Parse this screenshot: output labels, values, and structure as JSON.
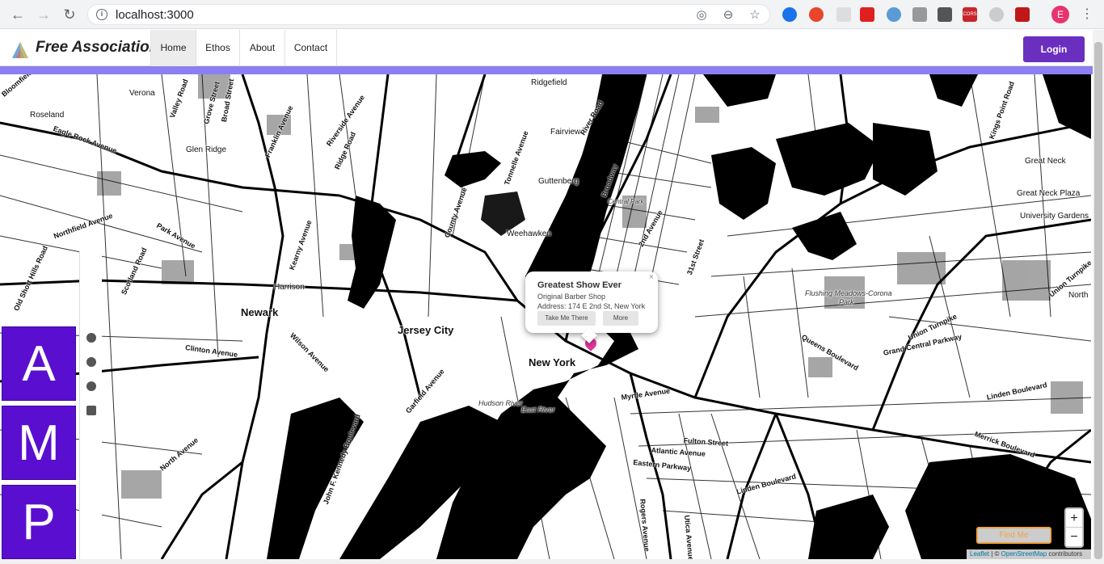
{
  "browser": {
    "url": "localhost:3000",
    "profile_initial": "E",
    "back_icon": "back-arrow-icon",
    "forward_icon": "forward-arrow-icon",
    "reload_icon": "reload-icon",
    "extensions_label_cors": "CORS"
  },
  "header": {
    "brand": "Free Associations",
    "nav": [
      "Home",
      "Ethos",
      "About",
      "Contact"
    ],
    "active_nav": "Home",
    "login_label": "Login",
    "accent_color": "#8c7ff2",
    "login_color": "#6b2fc0"
  },
  "map": {
    "places": {
      "new_york": "New York",
      "jersey_city": "Jersey City",
      "newark": "Newark",
      "harrison": "Harrison",
      "weehawken": "Weehawken",
      "guttenberg": "Guttenberg",
      "fairview": "Fairview",
      "ridgefield": "Ridgefield",
      "verona": "Verona",
      "roseland": "Roseland",
      "glen_ridge": "Glen Ridge",
      "great_neck": "Great Neck",
      "great_neck_plaza": "Great Neck Plaza",
      "university_gardens": "University Gardens",
      "north": "North",
      "hudson_river": "Hudson River",
      "east_river": "East River",
      "flushing_meadows": "Flushing Meadows-Corona",
      "park": "Park",
      "central_park": "Central Park"
    },
    "roads": {
      "bloomfield": "Bloomfield Avenue",
      "eagle_rock": "Eagle Rock Avenue",
      "valley": "Valley Road",
      "grove": "Grove Street",
      "broad": "Broad Street",
      "franklin": "Franklin Avenue",
      "park_ave": "Park Avenue",
      "northfield": "Northfield Avenue",
      "scotland": "Scotland Road",
      "old_short_hills": "Old Short Hills Road",
      "clinton": "Clinton Avenue",
      "wilson": "Wilson Avenue",
      "garfield": "Garfield Avenue",
      "jfk": "John F. Kennedy Boulevard",
      "north_ave": "North Avenue",
      "myrtle": "Myrtle Avenue",
      "fulton": "Fulton Street",
      "atlantic": "Atlantic Avenue",
      "eastern_parkway": "Eastern Parkway",
      "rogers": "Rogers Avenue",
      "utica": "Utica Avenue",
      "linden": "Linden Boulevard",
      "linden2": "Linden Boulevard",
      "merrick": "Merrick Boulevard",
      "queens_blvd": "Queens Boulevard",
      "union_tpk": "Union Turnpike",
      "grand_central": "Grand Central Parkway",
      "union_tpk2": "Union Turnpike",
      "kings_point": "Kings Point Road",
      "river_road": "River Road",
      "tonnelle": "Tonnelle Avenue",
      "county": "County Avenue",
      "kearny": "Kearny Avenue",
      "broadway": "Broadway",
      "second_ave": "2nd Avenue",
      "street_31": "31st Street",
      "ridge": "Ridge Road",
      "riverside": "Riverside Avenue"
    },
    "popup": {
      "title": "Greatest Show Ever",
      "venue": "Original Barber Shop",
      "address": "Address: 174 E 2nd St, New York",
      "btn_directions": "Take Me There",
      "btn_more": "More",
      "close": "×"
    },
    "marker_color": "#e0369a",
    "zoom_in": "+",
    "zoom_out": "−",
    "find_me": "Find Me",
    "attribution_leaflet": "Leaflet",
    "attribution_sep": " | © ",
    "attribution_osm": "OpenStreetMap",
    "attribution_tail": " contributors"
  },
  "amp_panel": {
    "letters": [
      "A",
      "M",
      "P"
    ],
    "color": "#5a0fd0",
    "tools": [
      "globe-icon",
      "info-icon",
      "clock-icon",
      "tag-icon"
    ]
  }
}
